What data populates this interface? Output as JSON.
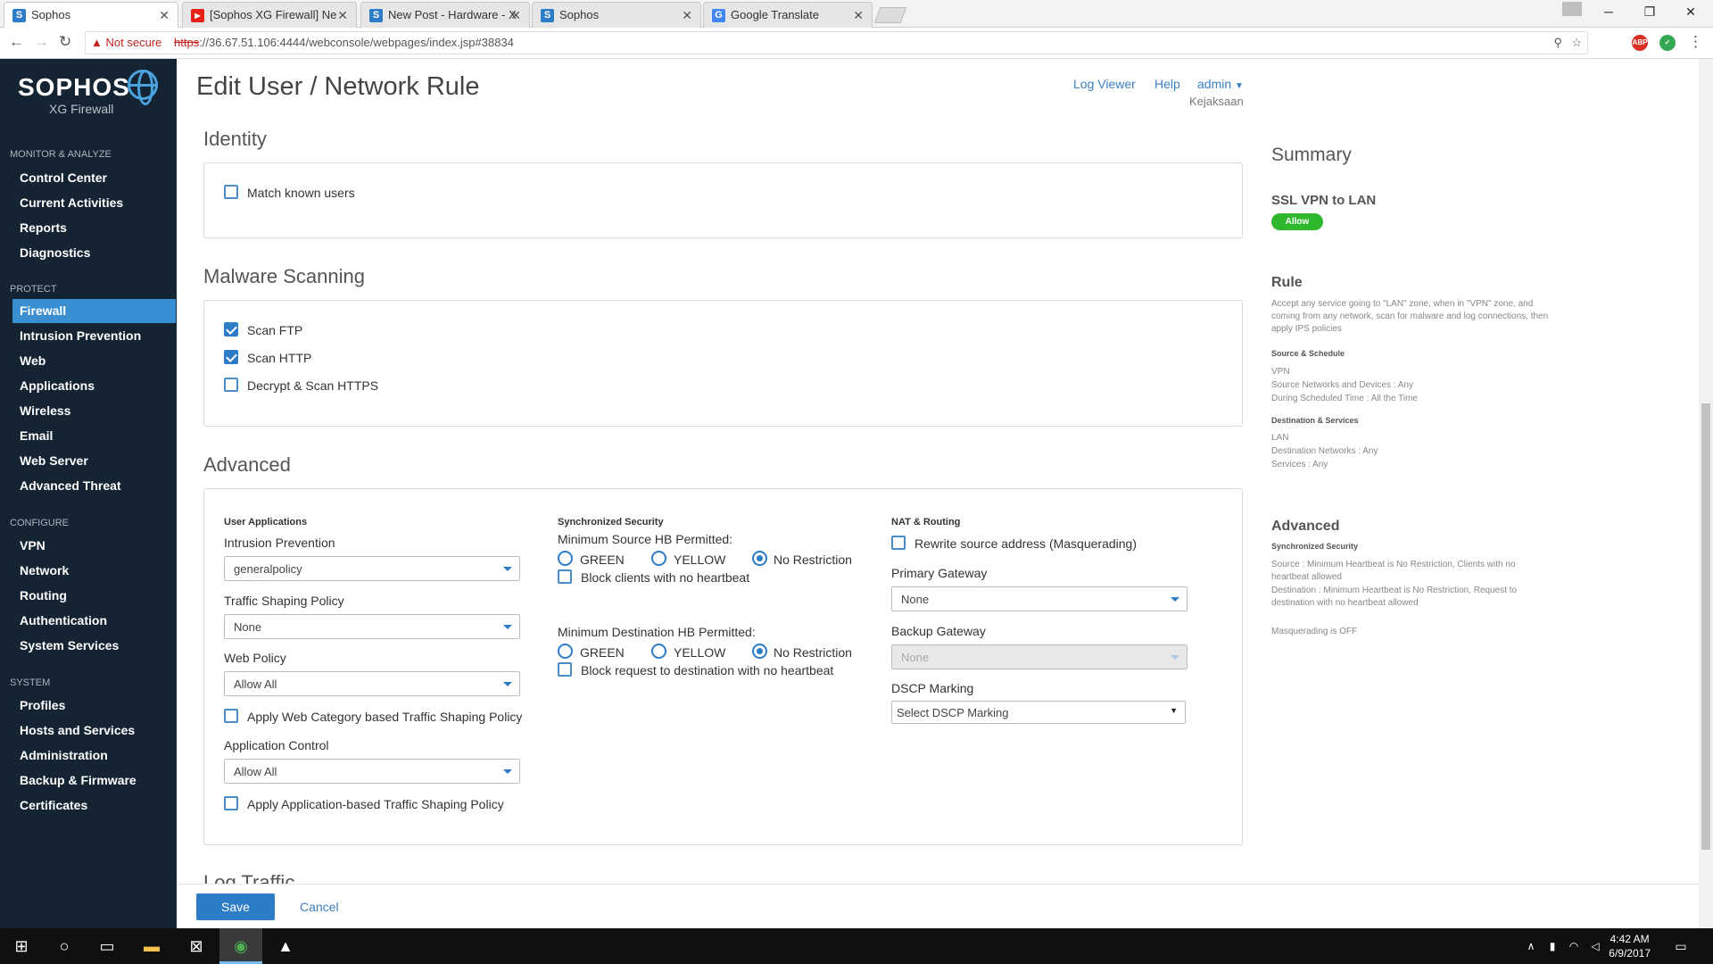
{
  "browser": {
    "tabs": [
      {
        "title": "Sophos",
        "favicon": "S",
        "color": "#2d7cc7",
        "active": true
      },
      {
        "title": "[Sophos XG Firewall] Ne",
        "favicon": "▶",
        "color": "#e62117",
        "active": false
      },
      {
        "title": "New Post - Hardware - X",
        "favicon": "S",
        "color": "#2d7cc7",
        "active": false
      },
      {
        "title": "Sophos",
        "favicon": "S",
        "color": "#2d7cc7",
        "active": false
      },
      {
        "title": "Google Translate",
        "favicon": "G",
        "color": "#4285f4",
        "active": false
      }
    ],
    "not_secure": "Not secure",
    "url_scheme": "https",
    "url_rest": "://36.67.51.106:4444/webconsole/webpages/index.jsp#38834"
  },
  "sidebar": {
    "brand": "SOPHOS",
    "product": "XG Firewall",
    "sections": [
      {
        "heading": "MONITOR & ANALYZE",
        "items": [
          "Control Center",
          "Current Activities",
          "Reports",
          "Diagnostics"
        ]
      },
      {
        "heading": "PROTECT",
        "items": [
          "Firewall",
          "Intrusion Prevention",
          "Web",
          "Applications",
          "Wireless",
          "Email",
          "Web Server",
          "Advanced Threat"
        ]
      },
      {
        "heading": "CONFIGURE",
        "items": [
          "VPN",
          "Network",
          "Routing",
          "Authentication",
          "System Services"
        ]
      },
      {
        "heading": "SYSTEM",
        "items": [
          "Profiles",
          "Hosts and Services",
          "Administration",
          "Backup & Firmware",
          "Certificates"
        ]
      }
    ],
    "active_item": "Firewall"
  },
  "header": {
    "title": "Edit User / Network Rule",
    "log_viewer": "Log Viewer",
    "help": "Help",
    "user": "admin",
    "org": "Kejaksaan"
  },
  "identity": {
    "title": "Identity",
    "match_known_users": {
      "label": "Match known users",
      "checked": false
    }
  },
  "malware": {
    "title": "Malware Scanning",
    "scan_ftp": {
      "label": "Scan FTP",
      "checked": true
    },
    "scan_http": {
      "label": "Scan HTTP",
      "checked": true
    },
    "decrypt_https": {
      "label": "Decrypt & Scan HTTPS",
      "checked": false
    }
  },
  "advanced": {
    "title": "Advanced",
    "user_apps": {
      "heading": "User Applications",
      "ips_label": "Intrusion Prevention",
      "ips_value": "generalpolicy",
      "traffic_label": "Traffic Shaping Policy",
      "traffic_value": "None",
      "web_label": "Web Policy",
      "web_value": "Allow All",
      "web_category_cb": "Apply Web Category based Traffic Shaping Policy",
      "app_label": "Application Control",
      "app_value": "Allow All",
      "app_shaping_cb": "Apply Application-based Traffic Shaping Policy"
    },
    "sync": {
      "heading": "Synchronized Security",
      "src_label": "Minimum Source HB Permitted:",
      "green": "GREEN",
      "yellow": "YELLOW",
      "no_restriction": "No Restriction",
      "block_clients": "Block clients with no heartbeat",
      "dst_label": "Minimum Destination HB Permitted:",
      "block_request": "Block request to destination with no heartbeat"
    },
    "nat": {
      "heading": "NAT & Routing",
      "rewrite": "Rewrite source address (Masquerading)",
      "primary_label": "Primary Gateway",
      "primary_value": "None",
      "backup_label": "Backup Gateway",
      "backup_value": "None",
      "dscp_label": "DSCP Marking",
      "dscp_value": "Select DSCP Marking"
    }
  },
  "log_traffic": "Log Traffic",
  "summary": {
    "title": "Summary",
    "rule_name": "SSL VPN to LAN",
    "action": "Allow",
    "rule_heading": "Rule",
    "rule_text": "Accept any service going to \"LAN\" zone, when in \"VPN\" zone, and coming from any network, scan for malware and log connections, then apply IPS policies",
    "src_heading": "Source & Schedule",
    "src_lines": [
      "VPN",
      "Source Networks and Devices : Any",
      "During Scheduled Time : All the Time"
    ],
    "dst_heading": "Destination & Services",
    "dst_lines": [
      "LAN",
      "Destination Networks : Any",
      "Services : Any"
    ],
    "adv_heading": "Advanced",
    "sync_heading": "Synchronized Security",
    "sync_src": "Source : Minimum Heartbeat is No Restriction, Clients with no heartbeat allowed",
    "sync_dst": "Destination : Minimum Heartbeat is No Restriction, Request to destination with no heartbeat allowed",
    "masq": "Masquerading is OFF"
  },
  "footer": {
    "save": "Save",
    "cancel": "Cancel"
  },
  "taskbar": {
    "time": "4:42 AM",
    "date": "6/9/2017"
  }
}
